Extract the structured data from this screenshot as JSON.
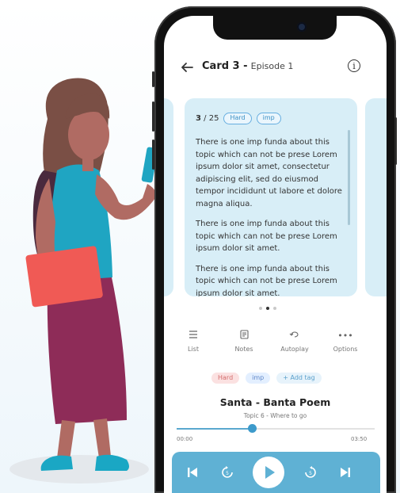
{
  "header": {
    "title": "Card 3 -",
    "episode": "Episode 1"
  },
  "card": {
    "current": "3",
    "total": "/ 25",
    "tags": [
      "Hard",
      "imp"
    ],
    "paragraphs": [
      "There is one imp funda about this topic which can not be prese Lorem ipsum dolor sit amet, consectetur adipiscing elit, sed do eiusmod tempor incididunt ut labore et dolore magna aliqua.",
      "There is one imp funda about this topic which can not be prese Lorem ipsum dolor sit amet.",
      "There is one imp funda about this topic which can not be prese Lorem ipsum dolor sit amet."
    ]
  },
  "pager": {
    "count": 3,
    "active_index": 1
  },
  "toolbar": {
    "list": "List",
    "notes": "Notes",
    "autoplay": "Autoplay",
    "options": "Options"
  },
  "tags_row": {
    "hard": "Hard",
    "imp": "imp",
    "add": "+ Add tag"
  },
  "track": {
    "title": "Santa - Banta Poem",
    "subtitle": "Topic 6 - Where to go",
    "current_time": "00:00",
    "duration": "03:50",
    "progress": 0.38
  },
  "colors": {
    "accent": "#5fb1d4",
    "card_bg": "#d8eef7",
    "tag_hard": "#fbe1e1",
    "tag_imp": "#e3efff"
  },
  "icons": {
    "back": "arrow-left-icon",
    "info": "info-icon",
    "list": "list-icon",
    "notes": "notes-icon",
    "autoplay": "repeat-icon",
    "options": "more-horizontal-icon",
    "prev": "skip-previous-icon",
    "rewind": "replay-5-icon",
    "play": "play-icon",
    "forward": "forward-5-icon",
    "next": "skip-next-icon"
  }
}
